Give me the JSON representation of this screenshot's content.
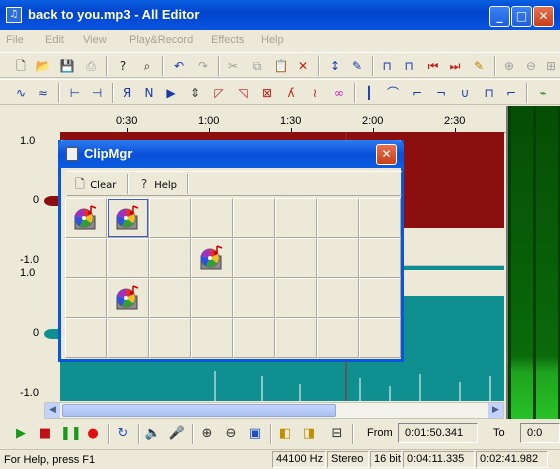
{
  "window": {
    "title": "back to you.mp3 - All Editor"
  },
  "menu": [
    "File",
    "Edit",
    "View",
    "Play&Record",
    "Effects",
    "Help"
  ],
  "ruler": {
    "ticks": [
      "0:30",
      "1:00",
      "1:30",
      "2:00",
      "2:30"
    ]
  },
  "channels": {
    "top": {
      "max": "1.0",
      "mid": "0",
      "min": "-1.0",
      "color": "#8b0f0f"
    },
    "bottom": {
      "max": "1.0",
      "mid": "0",
      "min": "-1.0",
      "color": "#0f8f8f"
    }
  },
  "dialog": {
    "title": "ClipMgr",
    "clear_label": "Clear",
    "help_label": "Help",
    "clips": [
      {
        "row": 0,
        "col": 0,
        "selected": false
      },
      {
        "row": 0,
        "col": 1,
        "selected": true
      },
      {
        "row": 1,
        "col": 3,
        "selected": false
      },
      {
        "row": 2,
        "col": 1,
        "selected": false
      }
    ]
  },
  "transport": {
    "from_label": "From",
    "from_value": "0:01:50.341",
    "to_label": "To",
    "to_value": "0:0"
  },
  "status": {
    "help_text": "For Help, press F1",
    "sample_rate": "44100 Hz",
    "channels": "Stereo",
    "bit_depth": "16 bit",
    "position": "0:04:11.335",
    "length": "0:02:41.982"
  }
}
